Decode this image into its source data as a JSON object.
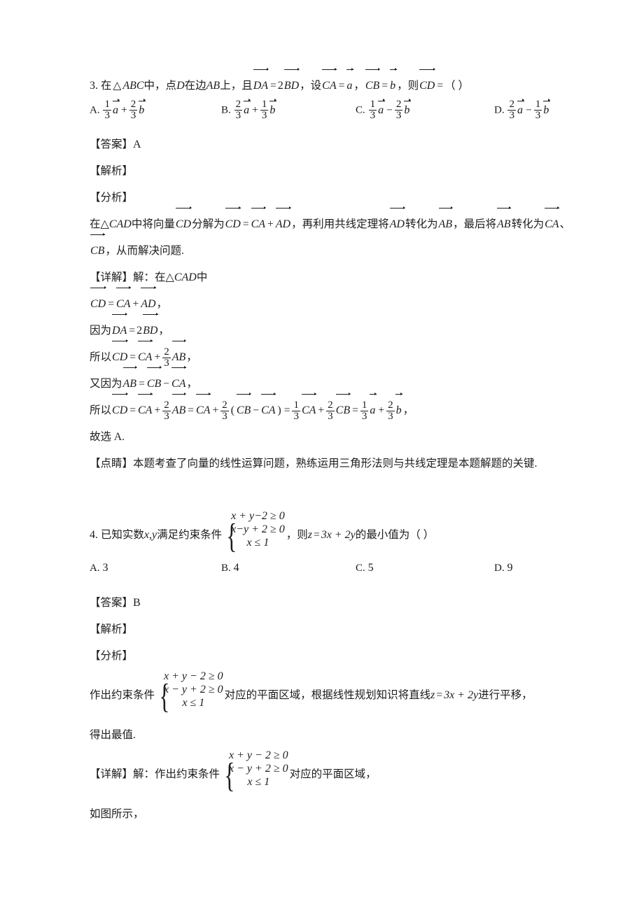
{
  "document": {
    "type": "math-exam-solutions",
    "language": "zh-CN"
  },
  "questions": [
    {
      "number": "3.",
      "stem": {
        "t1": "在",
        "tri": "△",
        "abc": "ABC",
        "t2": "中，",
        "t3": "点",
        "d": "D",
        "t4": "在边",
        "ab": "AB",
        "t5": "上，",
        "t6": "且",
        "da": "DA",
        "eq1": "=",
        "two": "2",
        "bd": "BD",
        "t7": "，",
        "t8": "设",
        "ca": "CA",
        "eq2": "=",
        "a": "a",
        "t9": "，",
        "cb": "CB",
        "eq3": "=",
        "b": "b",
        "t10": "，",
        "t11": "则",
        "cd": "CD",
        "eq4": "=",
        "paren": "（    ）"
      },
      "options": [
        {
          "label": "A.",
          "n1": "1",
          "d1": "3",
          "v1": "a",
          "op": "+",
          "n2": "2",
          "d2": "3",
          "v2": "b"
        },
        {
          "label": "B.",
          "n1": "2",
          "d1": "3",
          "v1": "a",
          "op": "+",
          "n2": "1",
          "d2": "3",
          "v2": "b"
        },
        {
          "label": "C.",
          "n1": "1",
          "d1": "3",
          "v1": "a",
          "op": "−",
          "n2": "2",
          "d2": "3",
          "v2": "b"
        },
        {
          "label": "D.",
          "n1": "2",
          "d1": "3",
          "v1": "a",
          "op": "−",
          "n2": "1",
          "d2": "3",
          "v2": "b"
        }
      ],
      "answer_tag": "【答案】",
      "answer_value": "A",
      "jiexi_tag": "【解析】",
      "fenxi_tag": "【分析】",
      "fenxi": {
        "p1": "在",
        "tri_cad": "△CAD",
        "p2": "中将向量",
        "cd": "CD",
        "p3": "分解为",
        "cd2": "CD",
        "eq": "=",
        "ca": "CA",
        "plus": "+",
        "ad": "AD",
        "p4": "，再利用共线定理将",
        "ad2": "AD",
        "p5": "转化为",
        "ab": "AB",
        "p6": "，最后将",
        "ab2": "AB",
        "p7": "转化为",
        "ca2": "CA",
        "dun": "、",
        "cb": "CB",
        "p8": "，从而解决问题."
      },
      "xiangjie_tag": "【详解】",
      "solution_lines": {
        "l1_pre": "解：在",
        "l1_tri": "△CAD",
        "l1_post": "中",
        "l2": {
          "cd": "CD",
          "eq": "=",
          "ca": "CA",
          "plus": "+",
          "ad": "AD",
          "comma": "，"
        },
        "l3": {
          "pre": "因为",
          "da": "DA",
          "eq": "=",
          "two": "2",
          "bd": "BD",
          "comma": "，"
        },
        "l4": {
          "pre": "所以",
          "cd": "CD",
          "eq": "=",
          "ca": "CA",
          "plus": "+",
          "num": "2",
          "den": "3",
          "ab": "AB",
          "comma": "，"
        },
        "l5": {
          "pre": "又因为",
          "ab": "AB",
          "eq": "=",
          "cb": "CB",
          "minus": "−",
          "ca": "CA",
          "comma": "，"
        },
        "l6": {
          "pre": "所以",
          "cd": "CD",
          "eq1": "=",
          "ca1": "CA",
          "plus1": "+",
          "n1": "2",
          "d1": "3",
          "ab": "AB",
          "eq2": "=",
          "ca2": "CA",
          "plus2": "+",
          "n2": "2",
          "d2": "3",
          "lp": "(",
          "cb1": "CB",
          "minus": "−",
          "ca3": "CA",
          "rp": ")",
          "eq3": "=",
          "n3": "1",
          "d3": "3",
          "ca4": "CA",
          "plus3": "+",
          "n4": "2",
          "d4": "3",
          "cb2": "CB",
          "eq4": "=",
          "n5": "1",
          "d5": "3",
          "a": "a",
          "plus4": "+",
          "n6": "2",
          "d6": "3",
          "b": "b",
          "comma": "，"
        },
        "l7": "故选 A."
      },
      "dianjing_tag": "【点睛】",
      "dianjing_text": "本题考查了向量的线性运算问题，熟练运用三角形法则与共线定理是本题解题的关键."
    },
    {
      "number": "4.",
      "stem": {
        "p1": "已知实数",
        "xy": "x,y",
        "p2": "满足约束条件",
        "sys": [
          "x + y−2 ≥ 0",
          "x−y + 2 ≥ 0",
          "x ≤ 1"
        ],
        "p3": "，则",
        "z": "z",
        "eq": "=",
        "expr": "3x + 2y",
        "p4": "的最小值为（    ）"
      },
      "options": [
        {
          "label": "A.",
          "value": "3"
        },
        {
          "label": "B.",
          "value": "4"
        },
        {
          "label": "C.",
          "value": "5"
        },
        {
          "label": "D.",
          "value": "9"
        }
      ],
      "answer_tag": "【答案】",
      "answer_value": "B",
      "jiexi_tag": "【解析】",
      "fenxi_tag": "【分析】",
      "fenxi": {
        "p1": "作出约束条件",
        "sys": [
          "x + y − 2 ≥ 0",
          "x − y + 2 ≥ 0",
          "x ≤ 1"
        ],
        "p2": "对应的平面区域，根据线性规划知识将直线",
        "z": "z",
        "eq": "=",
        "expr": "3x + 2y",
        "p3": "进行平移，",
        "p4": "得出最值."
      },
      "xiangjie_tag": "【详解】",
      "xiangjie": {
        "p1": "解：作出约束条件",
        "sys": [
          "x + y − 2 ≥ 0",
          "x − y + 2 ≥ 0",
          "x ≤ 1"
        ],
        "p2": "对应的平面区域，",
        "p3": "如图所示，"
      }
    }
  ]
}
